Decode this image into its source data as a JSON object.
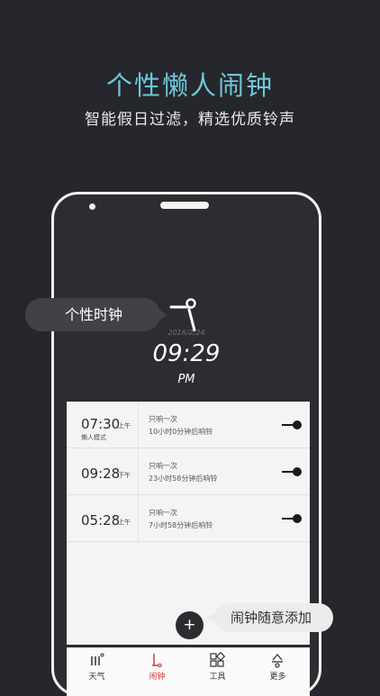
{
  "headline": "个性懒人闹钟",
  "subline": "智能假日过滤，精选优质铃声",
  "clock": {
    "date": "2016/2/24",
    "time": "09:29",
    "ampm": "PM"
  },
  "alarms": [
    {
      "time": "07:30",
      "ampm": "上午",
      "name": "懒人模式",
      "repeat": "只响一次",
      "remaining": "10小时0分钟后响铃"
    },
    {
      "time": "09:28",
      "ampm": "下午",
      "name": "",
      "repeat": "只响一次",
      "remaining": "23小时58分钟后响铃"
    },
    {
      "time": "05:28",
      "ampm": "上午",
      "name": "",
      "repeat": "只响一次",
      "remaining": "7小时58分钟后响铃"
    }
  ],
  "fab": {
    "symbol": "+"
  },
  "tabs": [
    {
      "label": "天气",
      "icon": "weather-icon"
    },
    {
      "label": "闹钟",
      "icon": "alarm-icon"
    },
    {
      "label": "工具",
      "icon": "tools-icon"
    },
    {
      "label": "更多",
      "icon": "more-icon"
    }
  ],
  "active_tab": "闹钟",
  "callouts": {
    "clock": "个性时钟",
    "add": "闹钟随意添加"
  },
  "colors": {
    "background": "#25272c",
    "headline": "#6ec6d8",
    "accent": "#c9413b"
  }
}
